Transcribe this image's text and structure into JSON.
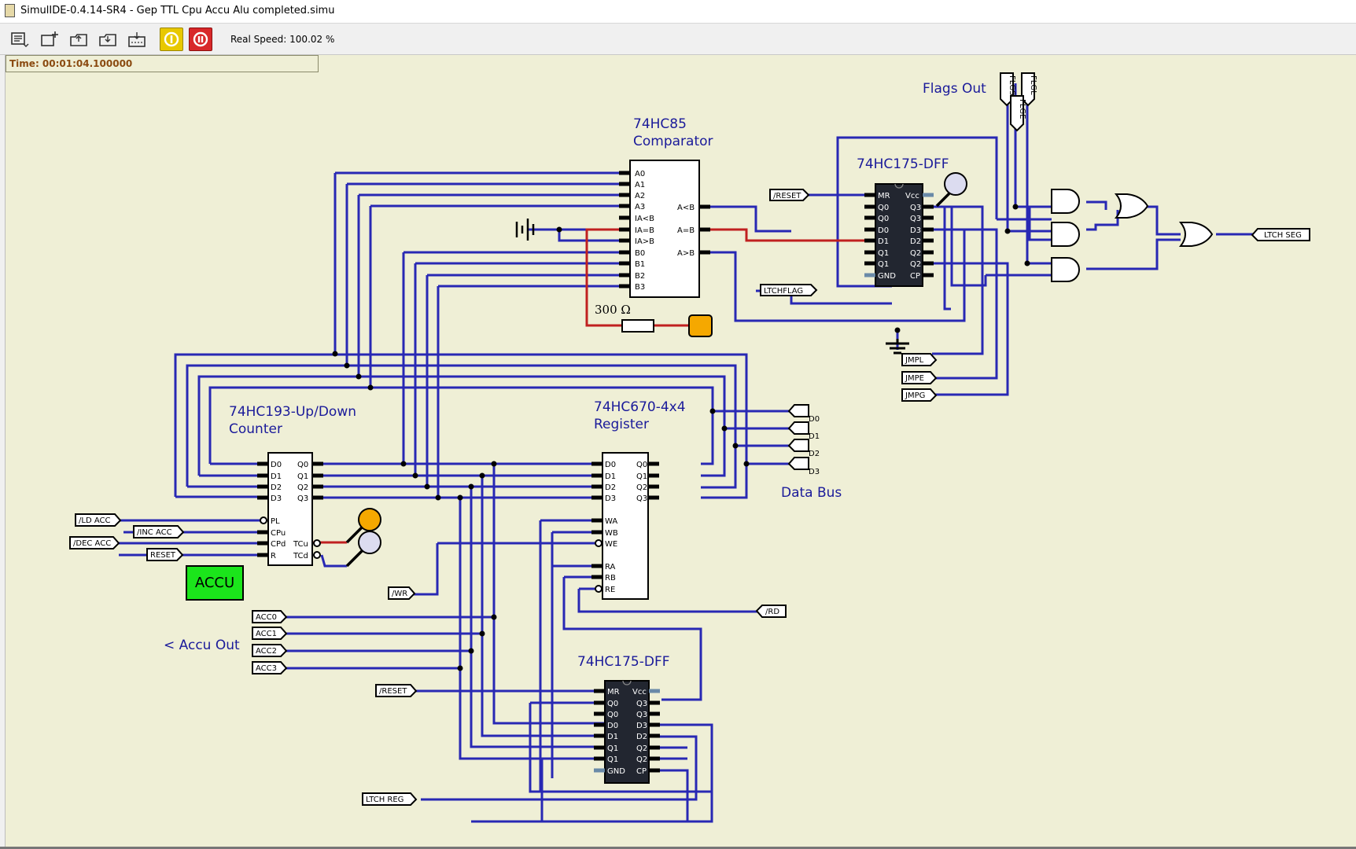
{
  "window": {
    "title": "SimulIDE-0.4.14-SR4  -  Gep TTL Cpu Accu Alu completed.simu"
  },
  "toolbar": {
    "buttons": [
      {
        "name": "file-menu-icon"
      },
      {
        "name": "new-circuit-icon"
      },
      {
        "name": "open-circuit-icon"
      },
      {
        "name": "save-circuit-icon"
      },
      {
        "name": "save-as-icon"
      },
      {
        "name": "power-icon"
      },
      {
        "name": "pause-icon"
      }
    ],
    "speed_label": "Real Speed: 100.02 %"
  },
  "status": {
    "time": "Time: 00:01:04.100000"
  },
  "colors": {
    "wire": "#2828b4",
    "wire_active": "#c02020",
    "chip_dark": "#222630",
    "led_green": "#1be51b",
    "led_orange": "#f5a800",
    "canvas": "#efefd6"
  },
  "labels": {
    "comparator_name": "74HC85",
    "comparator_desc": "Comparator",
    "dff1": "74HC175-DFF",
    "flags_out": "Flags Out",
    "counter_name": "74HC193-Up/Down",
    "counter_desc": "Counter",
    "register_name": "74HC670-4x4",
    "register_desc": "Register",
    "data_bus": "Data Bus",
    "accu_out": "< Accu Out",
    "dff2": "74HC175-DFF",
    "resistor": "300 Ω",
    "accu_button": "ACCU"
  },
  "comparator_pins": {
    "left": [
      "A0",
      "A1",
      "A2",
      "A3",
      "IA<B",
      "IA=B",
      "IA>B",
      "B0",
      "B1",
      "B2",
      "B3"
    ],
    "right": [
      "A<B",
      "A=B",
      "A>B"
    ]
  },
  "counter_pins": {
    "left": [
      "D0",
      "D1",
      "D2",
      "D3",
      "PL",
      "CPu",
      "CPd",
      "R"
    ],
    "right": [
      "Q0",
      "Q1",
      "Q2",
      "Q3",
      "TCu",
      "TCd"
    ]
  },
  "register_pins": {
    "left": [
      "D0",
      "D1",
      "D2",
      "D3",
      "WA",
      "WB",
      "WE",
      "RA",
      "RB",
      "RE"
    ],
    "right": [
      "Q0",
      "Q1",
      "Q2",
      "Q3"
    ]
  },
  "dff_pins": {
    "left": [
      "MR",
      "Q0",
      "Q0",
      "D0",
      "D1",
      "Q1",
      "Q1",
      "GND"
    ],
    "right": [
      "Vcc",
      "Q3",
      "Q3",
      "D3",
      "D2",
      "Q2",
      "Q2",
      "CP"
    ]
  },
  "tags": {
    "reset_top": "/RESET",
    "ltchflag": "LTCHFLAG",
    "ltch_seg": "LTCH SEG",
    "jmpl": "JMPL",
    "jmpe": "JMPE",
    "jmpg": "JMPG",
    "flgs": "FLGS",
    "flgl": "FLGL",
    "flge": "FLGE",
    "d0": "D0",
    "d1": "D1",
    "d2": "D2",
    "d3": "D3",
    "ld_acc": "/LD ACC",
    "inc_acc": "/INC ACC",
    "dec_acc": "/DEC ACC",
    "reset_acc": "RESET",
    "wr": "/WR",
    "rd": "/RD",
    "acc0": "ACC0",
    "acc1": "ACC1",
    "acc2": "ACC2",
    "acc3": "ACC3",
    "reset_bottom": "/RESET",
    "ltch_reg": "LTCH REG"
  }
}
